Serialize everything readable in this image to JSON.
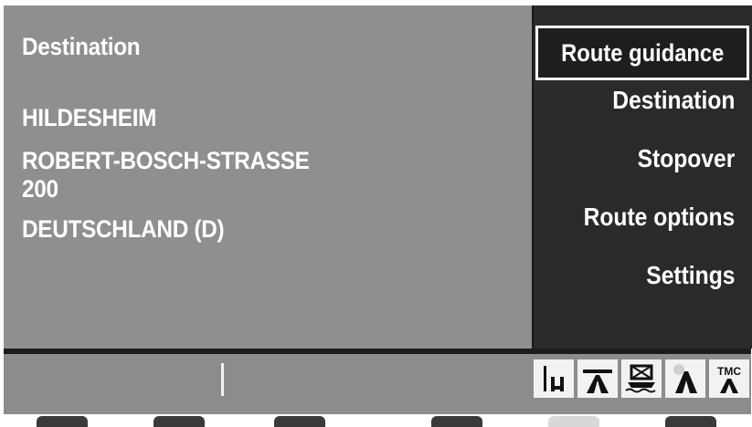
{
  "left": {
    "heading": "Destination",
    "city": "HILDESHEIM",
    "street": "ROBERT-BOSCH-STRASSE",
    "number": "200",
    "country": "DEUTSCHLAND (D)"
  },
  "menu": {
    "items": [
      {
        "label": "Route guidance",
        "selected": true
      },
      {
        "label": "Destination"
      },
      {
        "label": "Stopover"
      },
      {
        "label": "Route options"
      },
      {
        "label": "Settings"
      }
    ]
  },
  "status": {
    "icons": [
      "ferry-icon",
      "motorway-icon",
      "car-train-icon",
      "toll-road-icon",
      "tmc-traffic-icon"
    ],
    "tmc_label": "TMC"
  },
  "colors": {
    "panel": "#8f8f8f",
    "menu": "#2a2a2a",
    "text": "#ffffff"
  }
}
